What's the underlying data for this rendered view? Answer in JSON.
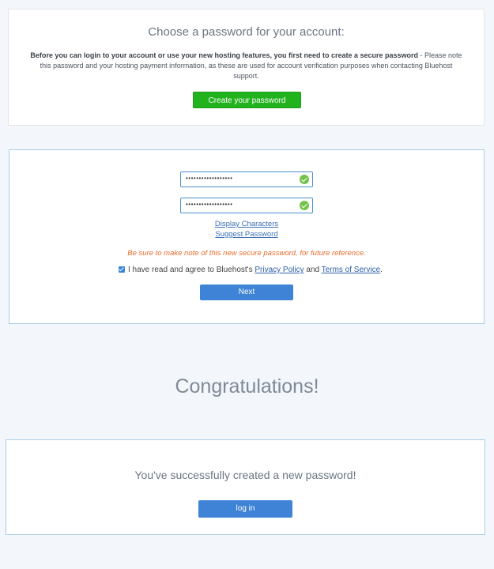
{
  "choose": {
    "title": "Choose a password for your account:",
    "desc_bold": "Before you can login to your account or use your new hosting features, you first need to create a secure password",
    "desc_rest": " - Please note this password and your hosting payment information, as these are used for account verification purposes when contacting Bluehost support.",
    "create_button": "Create your password"
  },
  "form": {
    "password_value": "••••••••••••••••••",
    "confirm_value": "••••••••••••••••••",
    "display_characters": "Display Characters",
    "suggest_password": "Suggest Password",
    "warning": "Be sure to make note of this new secure password, for future reference.",
    "agree_prefix": "I have read and agree to Bluehost's ",
    "privacy_policy": "Privacy Policy",
    "agree_and": " and ",
    "terms": "Terms of Service",
    "agree_suffix": ".",
    "agree_checked": true,
    "next_button": "Next"
  },
  "congrats": {
    "title": "Congratulations!",
    "message": "You've successfully created a new password!",
    "login_button": "log in"
  },
  "colors": {
    "green": "#22b21e",
    "blue": "#3e83d6",
    "warning": "#e86b2c",
    "check": "#73c24a"
  }
}
